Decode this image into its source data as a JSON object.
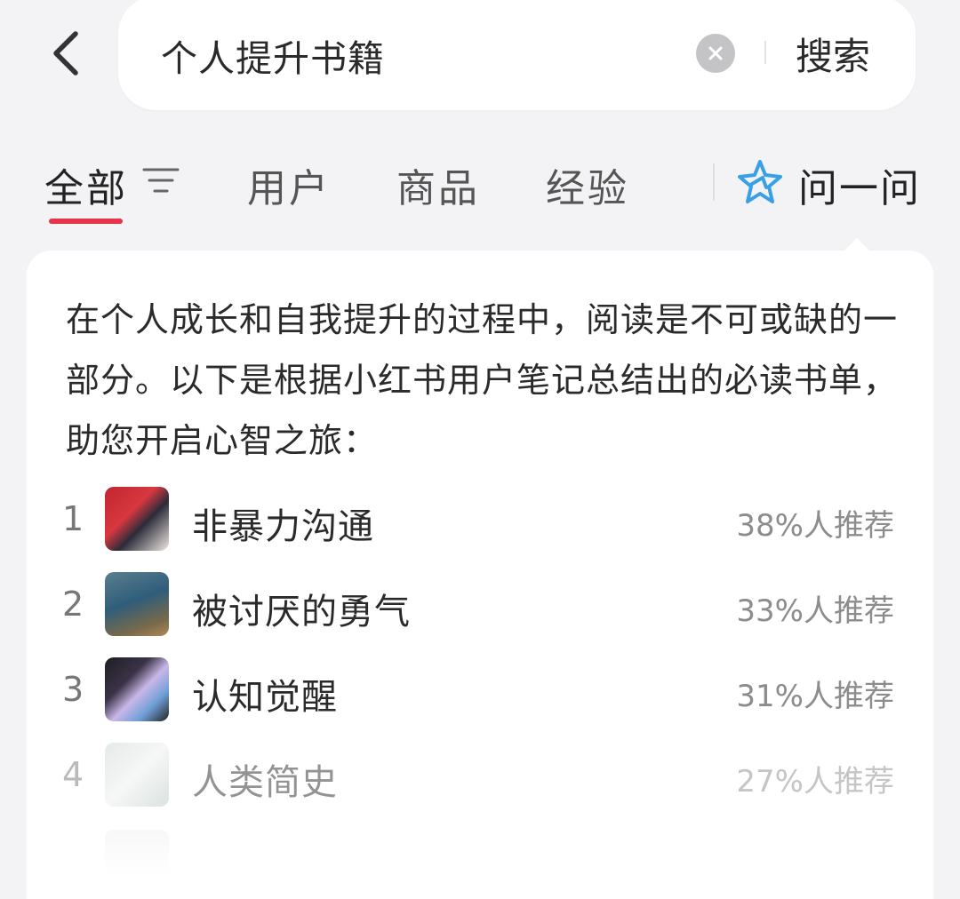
{
  "search": {
    "query": "个人提升书籍",
    "search_label": "搜索"
  },
  "tabs": [
    {
      "label": "全部"
    },
    {
      "label": "用户"
    },
    {
      "label": "商品"
    },
    {
      "label": "经验"
    }
  ],
  "ask": {
    "label": "问一问"
  },
  "answer": {
    "intro": "在个人成长和自我提升的过程中，阅读是不可或缺的一部分。以下是根据小红书用户笔记总结出的必读书单，助您开启心智之旅：",
    "books": [
      {
        "rank": "1",
        "title": "非暴力沟通",
        "pct": "38%人推荐"
      },
      {
        "rank": "2",
        "title": "被讨厌的勇气",
        "pct": "33%人推荐"
      },
      {
        "rank": "3",
        "title": "认知觉醒",
        "pct": "31%人推荐"
      },
      {
        "rank": "4",
        "title": "人类简史",
        "pct": "27%人推荐"
      }
    ]
  },
  "icons": {
    "back": "chevron-left-icon",
    "clear": "clear-icon",
    "filter": "filter-icon",
    "ask": "sparkle-star-icon"
  },
  "colors": {
    "accent": "#e8344a",
    "ask_icon": "#3aa0e6",
    "background": "#f3f3f5"
  }
}
